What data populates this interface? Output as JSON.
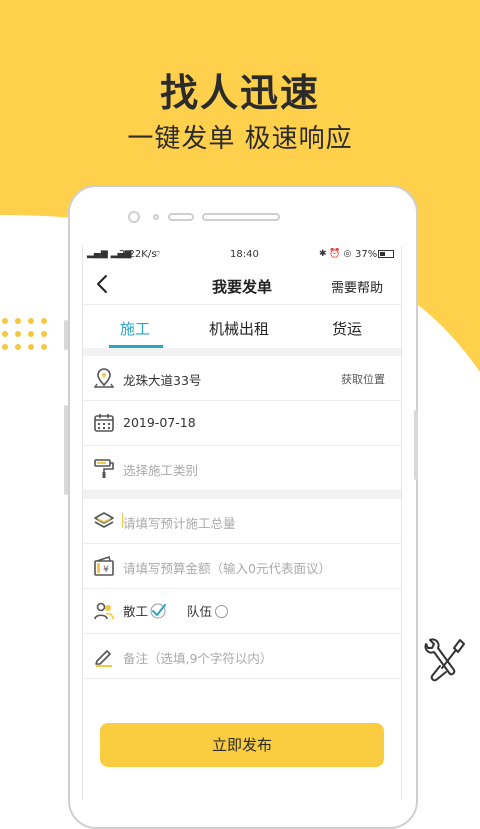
{
  "colors": {
    "brand_yellow": "#FFD04B",
    "accent_teal": "#2AA6C4",
    "button_yellow": "#F9CD3F"
  },
  "promo": {
    "headline": "找人迅速",
    "subheadline": "一键发单  极速响应"
  },
  "statusbar": {
    "network": "2.22K/s",
    "time": "18:40",
    "battery": "37%"
  },
  "navbar": {
    "title": "我要发单",
    "help_label": "需要帮助"
  },
  "tabs": [
    {
      "label": "施工",
      "active": true
    },
    {
      "label": "机械出租",
      "active": false
    },
    {
      "label": "货运",
      "active": false
    }
  ],
  "form": {
    "address": {
      "value": "龙珠大道33号",
      "action_label": "获取位置",
      "icon": "location-pin-icon"
    },
    "date": {
      "value": "2019-07-18",
      "icon": "calendar-icon"
    },
    "work_type": {
      "placeholder": "选择施工类别",
      "icon": "paint-roller-icon"
    },
    "quantity": {
      "placeholder": "请填写预计施工总量",
      "icon": "layers-icon"
    },
    "budget": {
      "placeholder": "请填写预算金额（输入0元代表面议）",
      "icon": "yen-bill-icon"
    },
    "crew_type": {
      "options": [
        "散工",
        "队伍"
      ],
      "selected": "散工",
      "icon": "people-icon"
    },
    "note": {
      "placeholder": "备注（选填,9个字符以内）",
      "icon": "pencil-icon"
    }
  },
  "submit_label": "立即发布"
}
